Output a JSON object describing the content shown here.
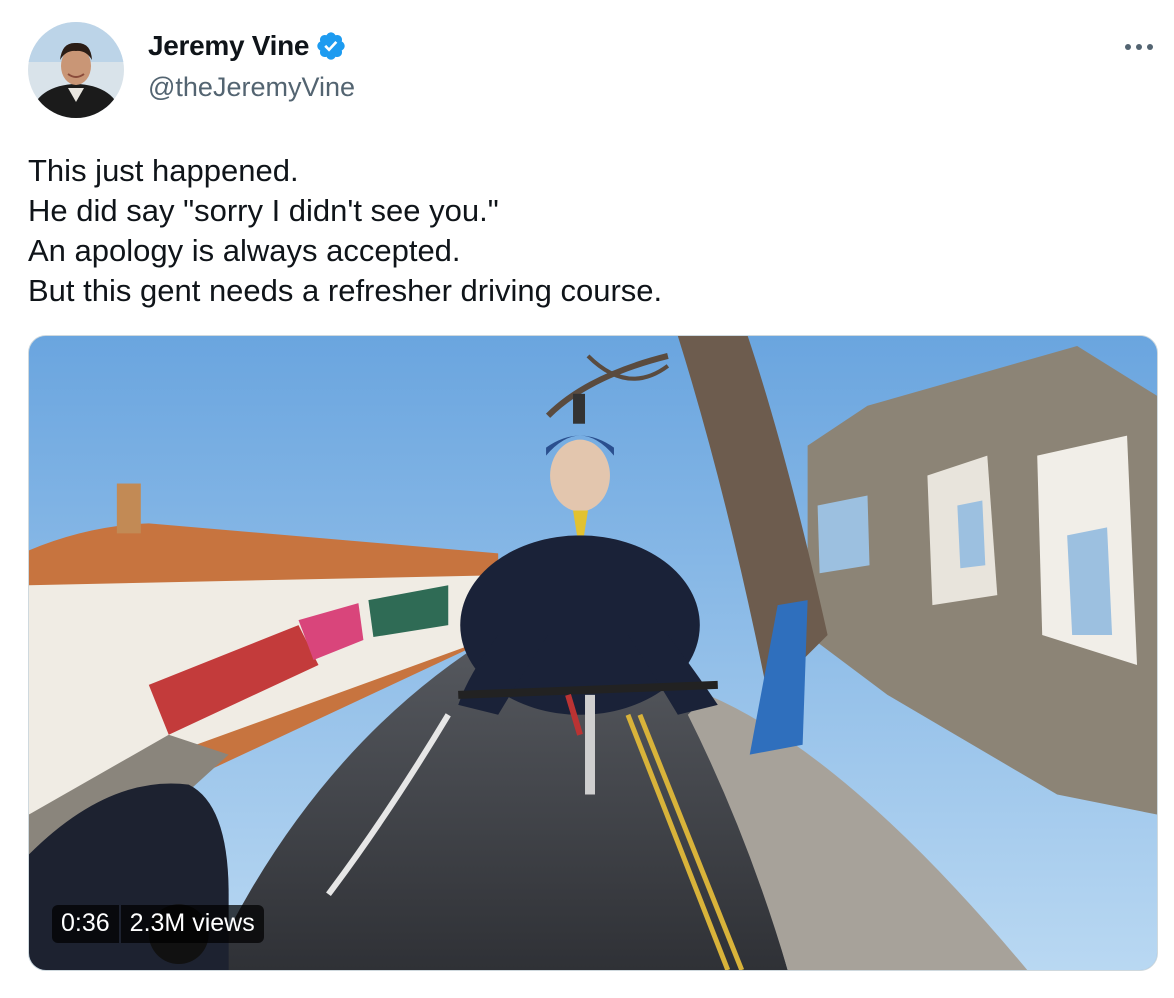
{
  "author": {
    "display_name": "Jeremy Vine",
    "handle": "@theJeremyVine",
    "verified_color": "#1d9bf0"
  },
  "tweet": {
    "lines": [
      "This just happened.",
      "He did say \"sorry I didn't see you.\"",
      "An apology is always accepted.",
      "But this gent needs a refresher driving course."
    ]
  },
  "media": {
    "duration": "0:36",
    "views": "2.3M views"
  },
  "icons": {
    "more": "more-options-icon",
    "verified": "verified-badge-icon"
  }
}
